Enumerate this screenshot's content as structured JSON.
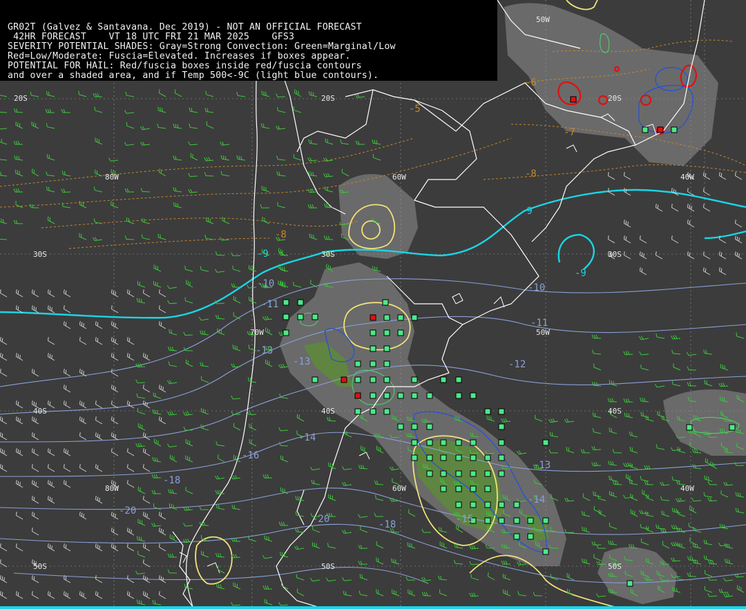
{
  "header": {
    "line1": "GR02T (Galvez & Santavana. Dec 2019) - NOT AN OFFICIAL FORECAST",
    "line2": " 42HR FORECAST    VT 18 UTC FRI 21 MAR 2025    GFS3",
    "line3": "SEVERITY POTENTIAL SHADES: Gray=Strong Convection: Green=Marginal/Low",
    "line4": "Red=Low/Moderate: Fuscia=Elevated. Increases if boxes appear.",
    "line5": "POTENTIAL FOR HAIL: Red/fuscia boxes inside red/fuscia contours",
    "line6": "and over a shaded area, and if Temp 500<-9C (light blue contours)."
  },
  "grid_labels": {
    "lon_50w_top": "50W",
    "lat_20s_a": "20S",
    "lat_20s_b": "20S",
    "lat_20s_c": "20S",
    "lon_80w_a": "80W",
    "lon_60w_a": "60W",
    "lon_40w_a": "40W",
    "lat_30s_a": "30S",
    "lat_30s_b": "30S",
    "lat_30s_c": "30S",
    "lon_70w": "70W",
    "lon_50w_mid": "50W",
    "lat_40s_a": "40S",
    "lat_40s_b": "40S",
    "lat_40s_c": "40S",
    "lon_80w_b": "80W",
    "lon_60w_b": "60W",
    "lon_40w_b": "40W",
    "lat_50s_a": "50S",
    "lat_50s_b": "50S",
    "lat_50s_c": "50S"
  },
  "temp_labels": {
    "t_m5": "-5",
    "t_m6": "-6",
    "t_m7": "-7",
    "t_m8_a": "-8",
    "t_m8_b": "-8",
    "t_m9_a": "-9",
    "t_m9_b": "-9",
    "t_m9_c": "-9",
    "t_m10_a": "-10",
    "t_m10_b": "-10",
    "t_m11_a": "-11",
    "t_m11_b": "-11",
    "t_m12": "-12",
    "t_m13_a": "-13",
    "t_m13_b": "-13",
    "t_m13_c": "-13",
    "t_m14_a": "-14",
    "t_m14_b": "-14",
    "t_m16": "-16",
    "t_m18_a": "-18",
    "t_m18_b": "-18",
    "t_m20_a": "-20",
    "t_m20_b": "-20",
    "t_m15": "-15"
  },
  "colors": {
    "background": "#3c3c3c",
    "header_bg": "#000000",
    "coast": "#ffffff",
    "gray_shade": "#7a7a7a",
    "green_shade": "#5d8a3a",
    "green_box": "#4ee88a",
    "red_box": "#e01010",
    "cold_contour": "#19d6e6",
    "isotherm": "#8aa0d8",
    "warm_isotherm": "#c8862a",
    "yellow_contour": "#f2e27a",
    "blue_contour": "#2050e0",
    "wind_barb": "#3cc83c"
  }
}
